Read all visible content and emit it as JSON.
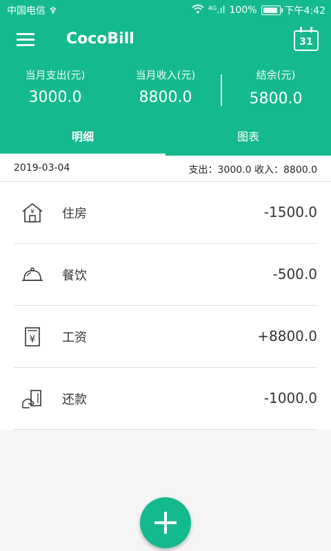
{
  "status_bar": {
    "carrier": "中国电信 ♆",
    "signal_text": "⁴ᴳ.ıl",
    "battery": "100%",
    "time": "下午4:42"
  },
  "app": {
    "title": "CocoBill",
    "calendar_day": "31"
  },
  "summary": {
    "expense_label": "当月支出(元)",
    "expense_value": "3000.0",
    "income_label": "当月收入(元)",
    "income_value": "8800.0",
    "balance_label": "结余(元)",
    "balance_value": "5800.0"
  },
  "tabs": [
    {
      "label": "明细",
      "active": true
    },
    {
      "label": "图表",
      "active": false
    }
  ],
  "date_header": {
    "date": "2019-03-04",
    "totals": "支出：3000.0 收入：8800.0"
  },
  "records": [
    {
      "label": "住房",
      "amount": "-1500.0",
      "icon": "house-icon"
    },
    {
      "label": "餐饮",
      "amount": "-500.0",
      "icon": "food-cloche-icon"
    },
    {
      "label": "工资",
      "amount": "+8800.0",
      "icon": "salary-icon"
    },
    {
      "label": "还款",
      "amount": "-1000.0",
      "icon": "card-repay-icon"
    }
  ],
  "colors": {
    "primary": "#15b98f",
    "background": "#f5f5f5",
    "divider": "#dddddd"
  }
}
